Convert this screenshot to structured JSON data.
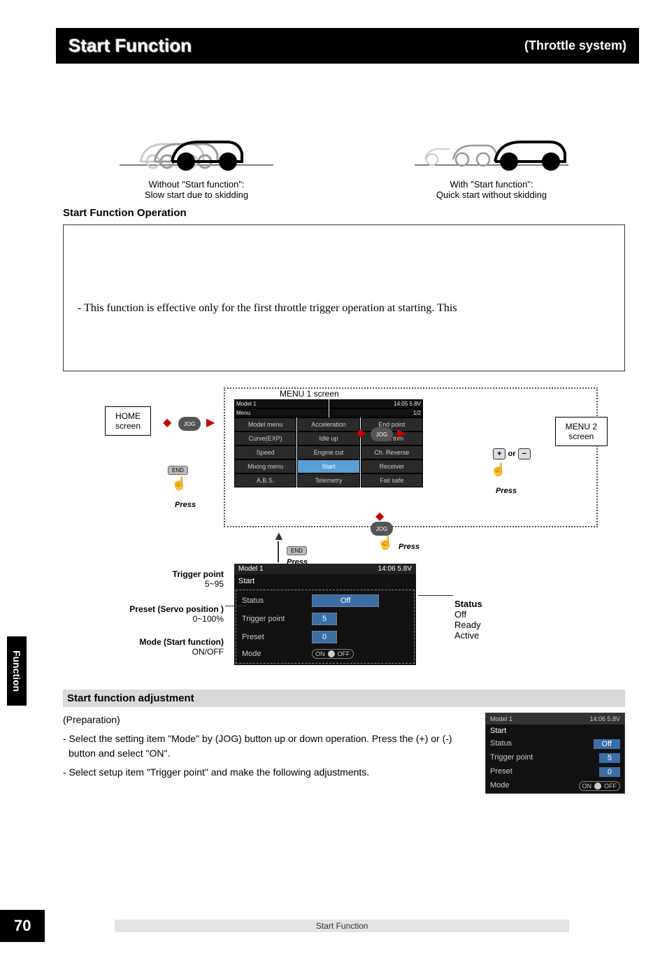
{
  "header": {
    "title": "Start Function",
    "right": "(Throttle system)"
  },
  "illus": {
    "left_cap1": "Without \"Start function\":",
    "left_cap2": "Slow start due to skidding",
    "right_cap1": "With \"Start function\":",
    "right_cap2": "Quick start without skidding"
  },
  "op_heading": "Start Function Operation",
  "box_text": "- This function is effective only for the first throttle trigger operation at starting. This",
  "nav": {
    "home": "HOME\nscreen",
    "menu2": "MENU 2\nscreen",
    "menu1_label": "MENU 1 screen",
    "jog": "JOG",
    "press": "Press",
    "end": "END",
    "or": "or",
    "plus": "+",
    "minus": "−"
  },
  "menu1": {
    "topbar_left": "Model 1",
    "topbar_right": "14:05 5.8V",
    "subtitle_left": "Menu",
    "subtitle_right": "1/2",
    "rows": [
      [
        "Model menu",
        "Acceleration",
        "End point"
      ],
      [
        "Curve(EXP)",
        "Idle up",
        "Sub trim"
      ],
      [
        "Speed",
        "Engine cut",
        "Ch. Reverse"
      ],
      [
        "Mixing menu",
        "Start",
        "Receiver"
      ],
      [
        "A.B.S.",
        "Telemetry",
        "Fail safe"
      ]
    ],
    "highlight": [
      3,
      1
    ]
  },
  "start_screen": {
    "topbar_left": "Model 1",
    "topbar_right": "14:06 5.8V",
    "title": "Start",
    "status_label": "Status",
    "status_value": "Off",
    "trigger_label": "Trigger point",
    "trigger_value": "5",
    "preset_label": "Preset",
    "preset_value": "0",
    "mode_label": "Mode",
    "mode_on": "ON",
    "mode_off": "OFF"
  },
  "annot": {
    "trigger_title": "Trigger point",
    "trigger_range": "5~95",
    "preset_title": "Preset (Servo position )",
    "preset_range": "0~100%",
    "mode_title": "Mode (Start function)",
    "mode_range": "ON/OFF",
    "status_title": "Status",
    "status_opts": [
      "Off",
      "Ready",
      "Active"
    ]
  },
  "adj": {
    "heading": "Start function adjustment",
    "prep": "(Preparation)",
    "step1": "- Select the setting item \"Mode\" by (JOG) button up or down operation. Press the (+) or (-) button and select \"ON\".",
    "step2": "- Select setup item \"Trigger point\" and make the following adjustments."
  },
  "mini": {
    "top_left": "Model 1",
    "top_right": "14:06 5.8V",
    "title": "Start",
    "status_l": "Status",
    "status_v": "Off",
    "trig_l": "Trigger point",
    "trig_v": "5",
    "preset_l": "Preset",
    "preset_v": "0",
    "mode_l": "Mode",
    "mode_on": "ON",
    "mode_off": "OFF"
  },
  "side_tab": "Function",
  "footer_title": "Start Function",
  "page_num": "70"
}
